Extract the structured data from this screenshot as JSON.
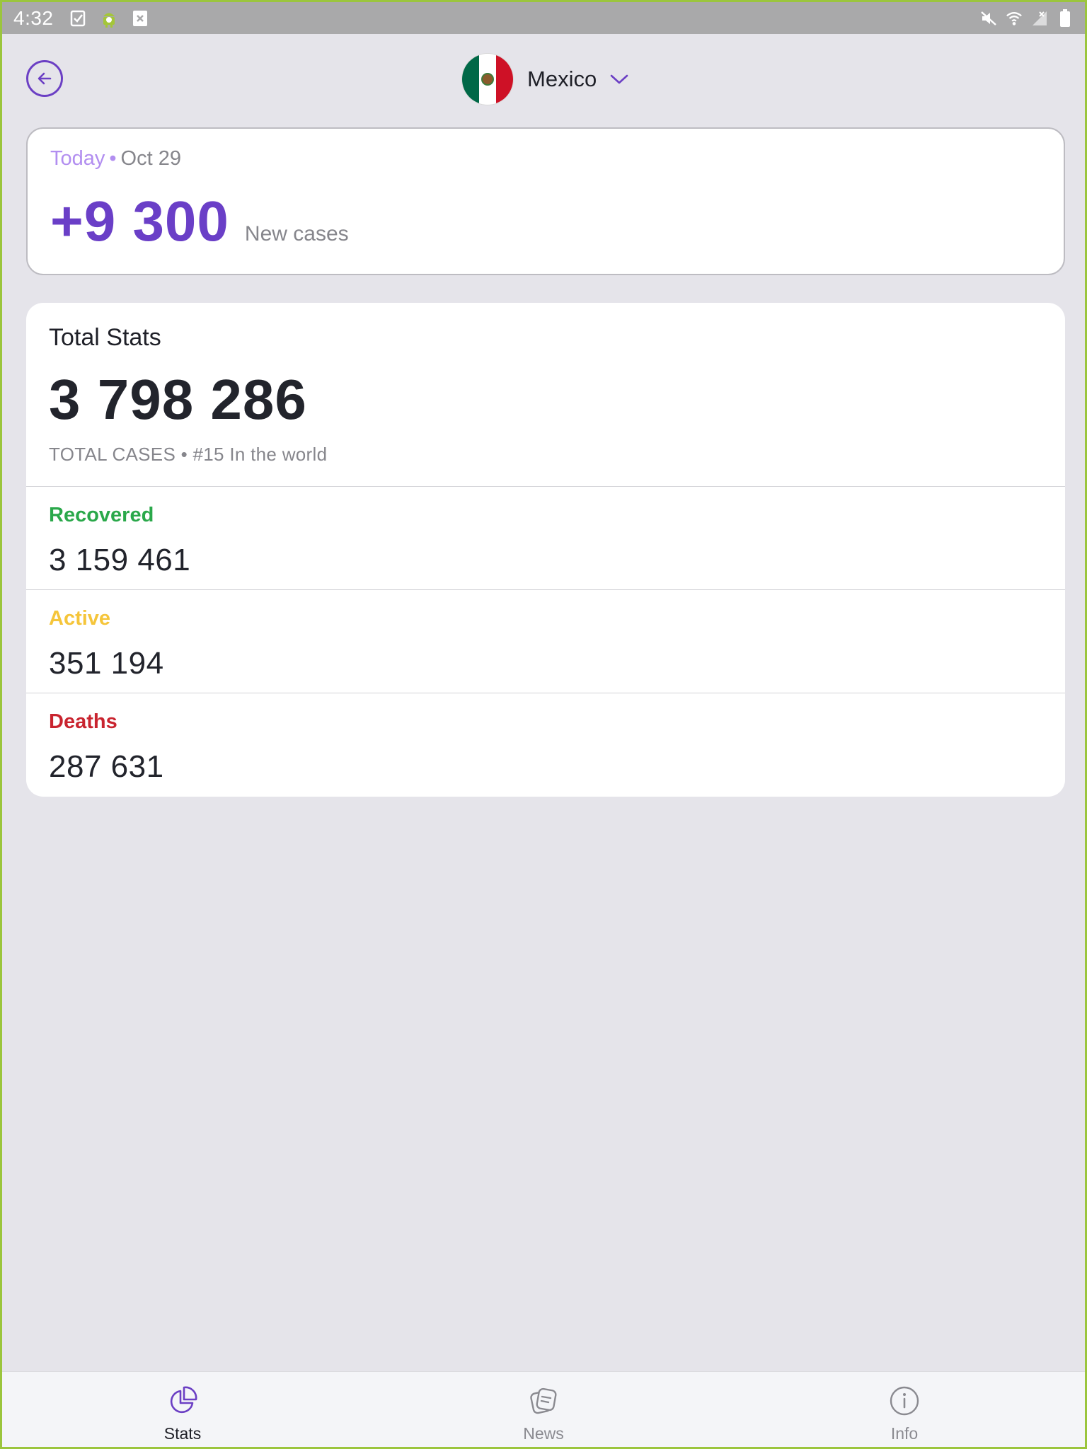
{
  "status_bar": {
    "time": "4:32",
    "left_icons": [
      "checklist-icon",
      "android-icon",
      "close-box-icon"
    ],
    "right_icons": [
      "mute-icon",
      "wifi-icon",
      "no-signal-icon",
      "battery-icon"
    ]
  },
  "header": {
    "back_icon": "arrow-left-icon",
    "country": "Mexico",
    "dropdown_icon": "chevron-down-icon"
  },
  "today": {
    "label": "Today",
    "separator": "•",
    "date": "Oct 29",
    "new_cases": "+9 300",
    "new_cases_label": "New cases"
  },
  "total_stats": {
    "title": "Total Stats",
    "total_cases": "3 798 286",
    "subtitle": "TOTAL CASES • #15 In the world",
    "rows": [
      {
        "label": "Recovered",
        "value": "3 159 461",
        "color": "#2aa84a"
      },
      {
        "label": "Active",
        "value": "351 194",
        "color": "#f5c53a"
      },
      {
        "label": "Deaths",
        "value": "287 631",
        "color": "#c9242f"
      }
    ]
  },
  "bottom_nav": {
    "items": [
      {
        "label": "Stats",
        "icon": "pie-chart-icon",
        "active": true
      },
      {
        "label": "News",
        "icon": "news-icon",
        "active": false
      },
      {
        "label": "Info",
        "icon": "info-icon",
        "active": false
      }
    ]
  },
  "colors": {
    "accent": "#6a3fc7",
    "background": "#e5e4ea"
  }
}
